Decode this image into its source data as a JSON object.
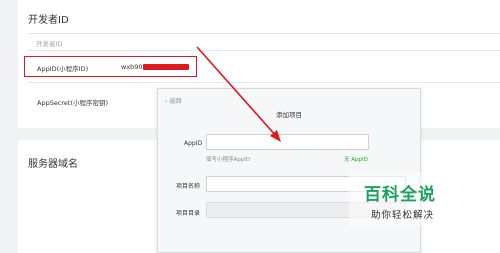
{
  "developer": {
    "section_title": "开发者ID",
    "sub_header": "开发者ID",
    "appid_label": "AppID(小程序ID)",
    "appid_value": "wxb90a",
    "appsecret_label": "AppSecret(小程序密钥)"
  },
  "server": {
    "section_title": "服务器域名"
  },
  "dialog": {
    "back_label": "返回",
    "title": "添加项目",
    "appid_label": "AppID",
    "appid_hint": "填写小程序AppID",
    "no_appid_link": "无 AppID",
    "project_name_label": "项目名称",
    "project_dir_label": "项目目录"
  },
  "watermark": {
    "title": "百科全说",
    "subtitle": "助你轻松解决"
  },
  "colors": {
    "highlight": "#e0191e",
    "link_green": "#1aad19",
    "watermark_green": "#1aa35f"
  }
}
